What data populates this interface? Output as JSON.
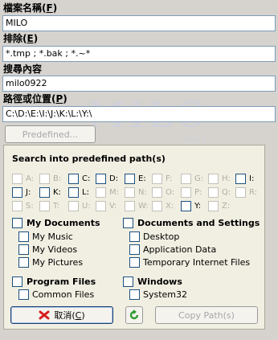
{
  "fields": [
    {
      "label": "檔案名稱",
      "hotkey": "F",
      "value": "MILO"
    },
    {
      "label": "排除",
      "hotkey": "E",
      "value": "*.tmp ; *.bak ; *.~*"
    },
    {
      "label": "搜尋內容",
      "hotkey": "",
      "value": "milo0922"
    },
    {
      "label": "路徑或位置",
      "hotkey": "P",
      "value": "C:\\D:\\E:\\I:\\J:\\K:\\L:\\Y:\\"
    }
  ],
  "watermark": {
    "text": "MILO",
    "sub": "0922"
  },
  "predefined_button": "Predefined...",
  "panel_title": "Search into predefined path(s)",
  "drives": [
    {
      "letter": "A:",
      "enabled": false
    },
    {
      "letter": "B:",
      "enabled": false
    },
    {
      "letter": "C:",
      "enabled": true
    },
    {
      "letter": "D:",
      "enabled": true
    },
    {
      "letter": "E:",
      "enabled": true
    },
    {
      "letter": "F:",
      "enabled": false
    },
    {
      "letter": "G:",
      "enabled": false
    },
    {
      "letter": "H:",
      "enabled": false
    },
    {
      "letter": "I:",
      "enabled": true
    },
    {
      "letter": "J:",
      "enabled": true
    },
    {
      "letter": "K:",
      "enabled": true
    },
    {
      "letter": "L:",
      "enabled": true
    },
    {
      "letter": "M:",
      "enabled": false
    },
    {
      "letter": "N:",
      "enabled": false
    },
    {
      "letter": "O:",
      "enabled": false
    },
    {
      "letter": "P:",
      "enabled": false
    },
    {
      "letter": "Q:",
      "enabled": false
    },
    {
      "letter": "R:",
      "enabled": false
    },
    {
      "letter": "S:",
      "enabled": false
    },
    {
      "letter": "T:",
      "enabled": false
    },
    {
      "letter": "U:",
      "enabled": false
    },
    {
      "letter": "V:",
      "enabled": false
    },
    {
      "letter": "W:",
      "enabled": false
    },
    {
      "letter": "X:",
      "enabled": false
    },
    {
      "letter": "Y:",
      "enabled": true
    },
    {
      "letter": "Z:",
      "enabled": false
    }
  ],
  "groups": {
    "my_documents": {
      "label": "My Documents",
      "items": [
        "My Music",
        "My Videos",
        "My Pictures"
      ]
    },
    "docs_settings": {
      "label": "Documents and Settings",
      "items": [
        "Desktop",
        "Application Data",
        "Temporary Internet Files"
      ]
    },
    "program_files": {
      "label": "Program Files",
      "items": [
        "Common Files"
      ]
    },
    "windows": {
      "label": "Windows",
      "items": [
        "System32"
      ]
    }
  },
  "buttons": {
    "cancel": "取消",
    "cancel_hotkey": "C",
    "copy": "Copy Path(s)"
  },
  "colors": {
    "accent": "#1c5180",
    "cancel_icon": "#d81e1e",
    "refresh_icon": "#2e9b2e"
  }
}
